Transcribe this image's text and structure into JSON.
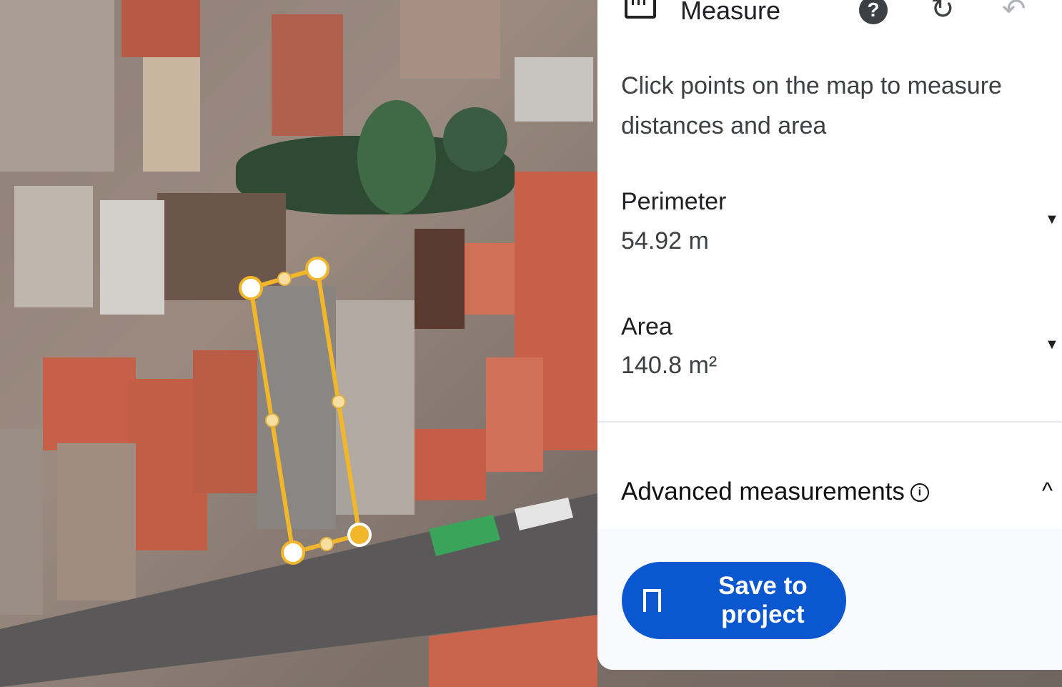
{
  "panel": {
    "title": "Measure",
    "help_icon": "help-circle-icon",
    "redo_icon": "redo-icon",
    "undo_icon": "undo-icon",
    "description": "Click points on the map to measure distances and area",
    "perimeter": {
      "label": "Perimeter",
      "value": "54.92 m"
    },
    "area": {
      "label": "Area",
      "value": "140.8 m²"
    },
    "advanced_label": "Advanced measurements",
    "save_label": "Save to project"
  },
  "colors": {
    "accent": "#0b57d0",
    "polygon": "#f2b62b"
  }
}
